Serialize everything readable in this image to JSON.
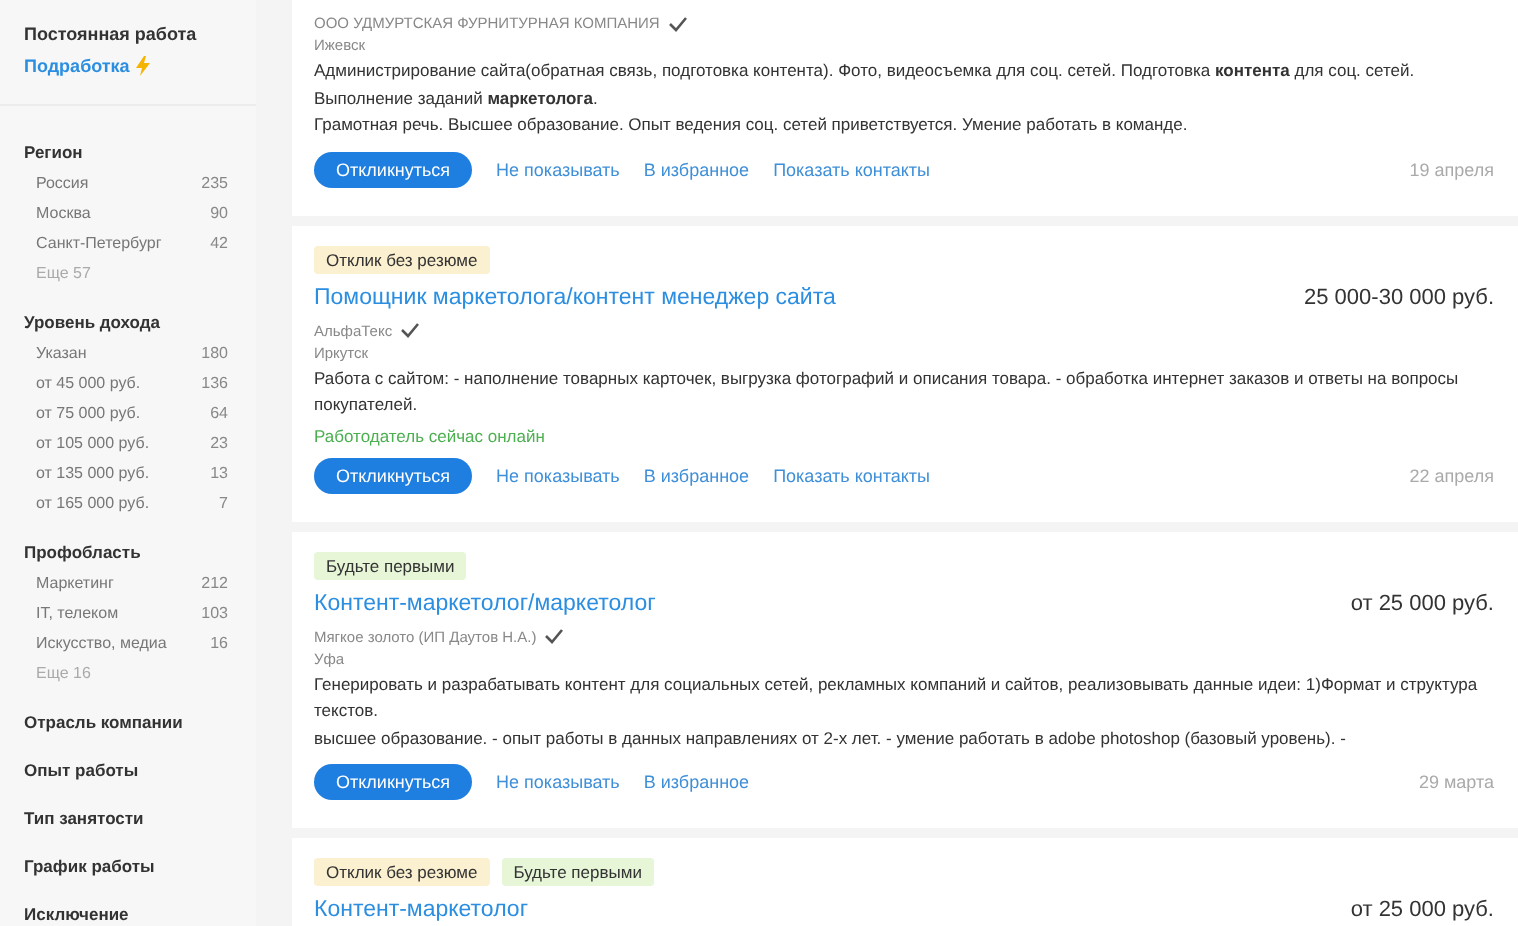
{
  "sidebar": {
    "employment": [
      {
        "label": "Постоянная работа",
        "kind": "title"
      },
      {
        "label": "Подработка",
        "kind": "link"
      }
    ],
    "filters": [
      {
        "title": "Регион",
        "items": [
          {
            "label": "Россия",
            "count": "235"
          },
          {
            "label": "Москва",
            "count": "90"
          },
          {
            "label": "Санкт-Петербург",
            "count": "42"
          }
        ],
        "more": "Еще 57"
      },
      {
        "title": "Уровень дохода",
        "items": [
          {
            "label": "Указан",
            "count": "180"
          },
          {
            "label": "от 45 000 руб.",
            "count": "136"
          },
          {
            "label": "от 75 000 руб.",
            "count": "64"
          },
          {
            "label": "от 105 000 руб.",
            "count": "23"
          },
          {
            "label": "от 135 000 руб.",
            "count": "13"
          },
          {
            "label": "от 165 000 руб.",
            "count": "7"
          }
        ]
      },
      {
        "title": "Профобласть",
        "items": [
          {
            "label": "Маркетинг",
            "count": "212"
          },
          {
            "label": "IT, телеком",
            "count": "103"
          },
          {
            "label": "Искусство, медиа",
            "count": "16"
          }
        ],
        "more": "Еще 16"
      },
      {
        "title": "Отрасль компании"
      },
      {
        "title": "Опыт работы"
      },
      {
        "title": "Тип занятости"
      },
      {
        "title": "График работы"
      },
      {
        "title": "Исключение"
      }
    ]
  },
  "vacancies": [
    {
      "company": "ООО УДМУРТСКАЯ ФУРНИТУРНАЯ КОМПАНИЯ",
      "verified": true,
      "city": "Ижевск",
      "description": [
        "Администрирование сайта(обратная связь, подготовка контента). Фото, видеосъемка для соц. сетей. Подготовка **контента** для соц. сетей. Выполнение заданий **маркетолога**.",
        "Грамотная речь. Высшее образование. Опыт ведения соц. сетей приветствуется. Умение работать в команде."
      ],
      "respond": "Откликнуться",
      "links": [
        "Не показывать",
        "В избранное",
        "Показать контакты"
      ],
      "date": "19 апреля"
    },
    {
      "badges": [
        {
          "text": "Отклик без резюме",
          "kind": "no-resume"
        }
      ],
      "title": "Помощник маркетолога/контент менеджер сайта",
      "salary": "25 000-30 000 руб.",
      "company": "АльфаТекс",
      "verified": true,
      "city": "Иркутск",
      "description": [
        "Работа с сайтом: - наполнение товарных карточек, выгрузка фотографий и описания товара. - обработка интернет заказов и ответы на вопросы покупателей."
      ],
      "online": "Работодатель сейчас онлайн",
      "respond": "Откликнуться",
      "links": [
        "Не показывать",
        "В избранное",
        "Показать контакты"
      ],
      "date": "22 апреля"
    },
    {
      "badges": [
        {
          "text": "Будьте первыми",
          "kind": "first"
        }
      ],
      "title": "Контент-маркетолог/маркетолог",
      "salary": "от 25 000 руб.",
      "company": "Мягкое золото (ИП Даутов Н.А.)",
      "verified": true,
      "city": "Уфа",
      "description": [
        "Генерировать и разрабатывать контент для социальных сетей, рекламных компаний и сайтов, реализовывать данные идеи: 1)Формат и структура текстов.",
        "высшее образование. - опыт работы в данных направлениях от 2-х лет. - умение работать в adobe photoshop (базовый уровень). -"
      ],
      "respond": "Откликнуться",
      "links": [
        "Не показывать",
        "В избранное"
      ],
      "date": "29 марта"
    },
    {
      "badges": [
        {
          "text": "Отклик без резюме",
          "kind": "no-resume"
        },
        {
          "text": "Будьте первыми",
          "kind": "first"
        }
      ],
      "title": "Контент-маркетолог",
      "salary": "от 25 000 руб."
    }
  ]
}
